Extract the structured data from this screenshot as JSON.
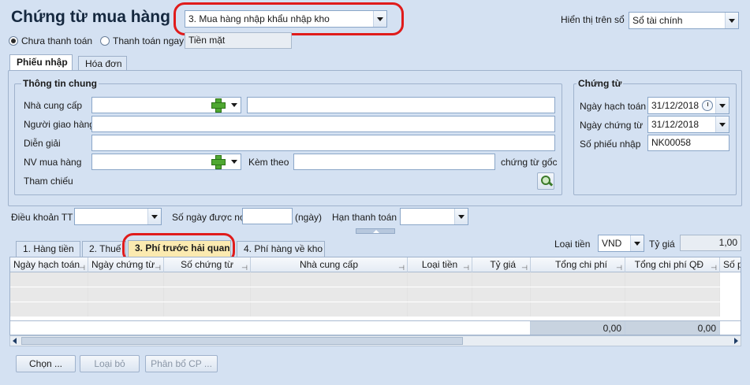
{
  "header": {
    "title": "Chứng từ mua hàng",
    "purchase_type": "3. Mua hàng nhập khẩu nhập kho",
    "display_on_book_label": "Hiển thị trên sổ",
    "display_on_book_value": "Sổ tài chính"
  },
  "payment": {
    "unpaid_label": "Chưa thanh toán",
    "paid_label": "Thanh toán ngay",
    "method_value": "Tiền mặt"
  },
  "top_tabs": [
    {
      "label": "Phiếu nhập"
    },
    {
      "label": "Hóa đơn"
    }
  ],
  "general_info": {
    "group_title": "Thông tin chung",
    "supplier_label": "Nhà cung cấp",
    "deliverer_label": "Người giao hàng",
    "description_label": "Diễn giải",
    "buyer_label": "NV mua hàng",
    "attached_label": "Kèm theo",
    "original_docs_label": "chứng từ gốc",
    "reference_label": "Tham chiếu"
  },
  "voucher": {
    "group_title": "Chứng từ",
    "posting_date_label": "Ngày hạch toán",
    "posting_date": "31/12/2018",
    "voucher_date_label": "Ngày chứng từ",
    "voucher_date": "31/12/2018",
    "receipt_no_label": "Số phiếu nhập",
    "receipt_no": "NK00058"
  },
  "terms": {
    "payment_terms_label": "Điều khoản TT",
    "credit_days_label": "Số ngày được nợ",
    "days_unit": "(ngày)",
    "due_date_label": "Hạn thanh toán"
  },
  "detail_tabs": [
    {
      "label": "1. Hàng tiền"
    },
    {
      "label": "2. Thuế"
    },
    {
      "label": "3. Phí trước hải quan"
    },
    {
      "label": "4. Phí hàng về kho"
    }
  ],
  "currency": {
    "label": "Loại tiền",
    "value": "VND",
    "rate_label": "Tỷ giá",
    "rate_value": "1,00"
  },
  "grid": {
    "columns": [
      "Ngày hạch toán",
      "Ngày chứng từ",
      "Số chứng từ",
      "Nhà cung cấp",
      "Loại tiền",
      "Tỷ giá",
      "Tổng chi phí",
      "Tổng chi phí QĐ",
      "Số p"
    ],
    "footer_total": "0,00",
    "footer_total_qd": "0,00"
  },
  "buttons": {
    "choose": "Chọn ...",
    "remove": "Loại bỏ",
    "allocate": "Phân bổ CP ..."
  }
}
